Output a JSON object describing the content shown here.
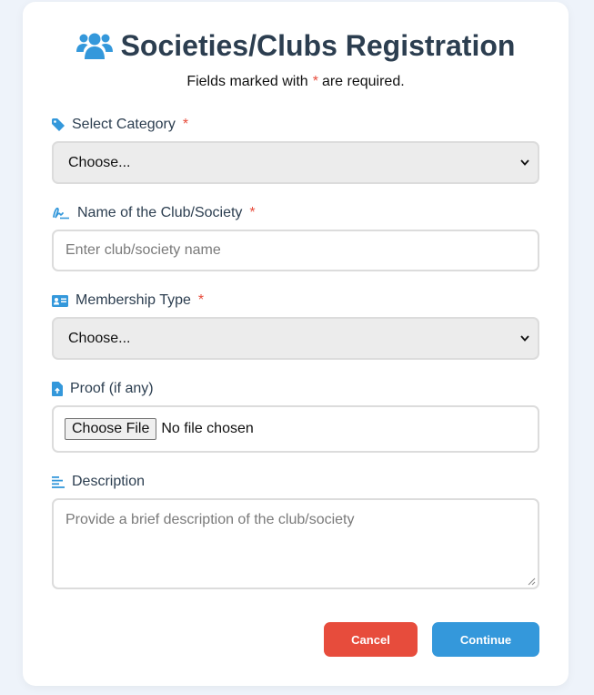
{
  "header": {
    "icon": "users-icon",
    "title": "Societies/Clubs Registration",
    "subtitle_prefix": "Fields marked with",
    "required_mark": "*",
    "subtitle_suffix": "are required."
  },
  "colors": {
    "accent": "#3498db",
    "required": "#e74c3c",
    "cancel": "#e74c3c",
    "continue": "#3498db",
    "text": "#2c3e50"
  },
  "form": {
    "category": {
      "icon": "tag-icon",
      "label": "Select Category",
      "required_mark": "*",
      "selected": "Choose..."
    },
    "name": {
      "icon": "signature-icon",
      "label": "Name of the Club/Society",
      "required_mark": "*",
      "placeholder": "Enter club/society name"
    },
    "membership": {
      "icon": "id-card-icon",
      "label": "Membership Type",
      "required_mark": "*",
      "selected": "Choose..."
    },
    "proof": {
      "icon": "file-upload-icon",
      "label": "Proof (if any)",
      "button_label": "Choose File",
      "status": "No file chosen"
    },
    "description": {
      "icon": "align-left-icon",
      "label": "Description",
      "placeholder": "Provide a brief description of the club/society"
    }
  },
  "actions": {
    "cancel_label": "Cancel",
    "continue_label": "Continue"
  }
}
